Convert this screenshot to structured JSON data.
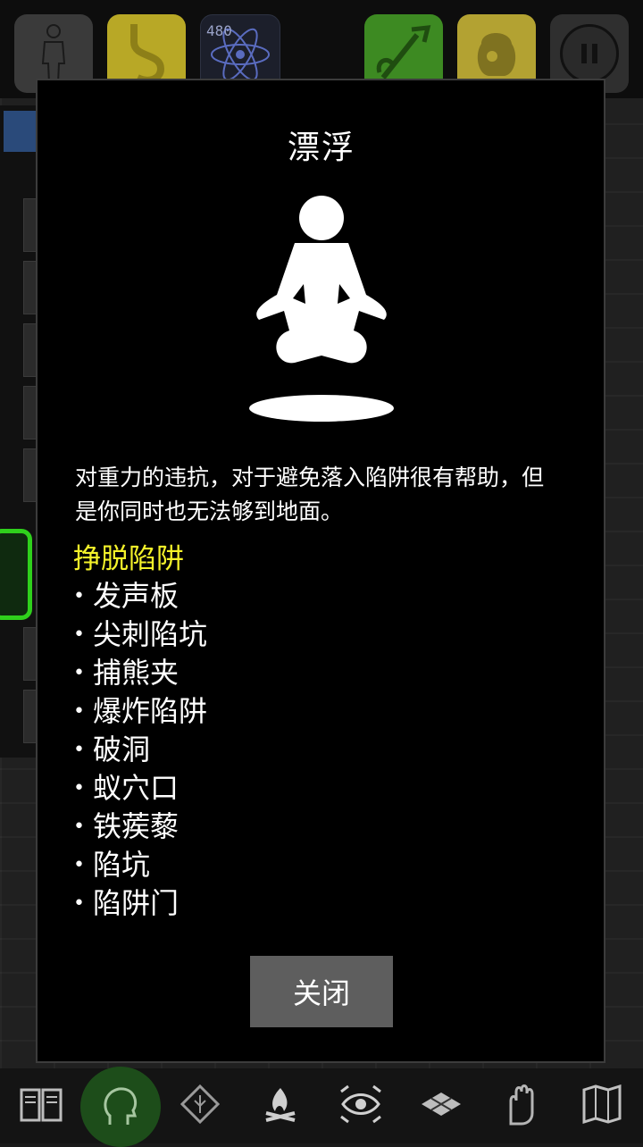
{
  "top_bar": {
    "buttons": [
      {
        "icon": "person-silhouette-icon"
      },
      {
        "icon": "stomach-icon"
      },
      {
        "icon": "atom-icon",
        "counter": "480"
      },
      {
        "icon": "quiver-arrows-icon"
      },
      {
        "icon": "backpack-sack-icon"
      },
      {
        "icon": "pause-icon"
      }
    ]
  },
  "dialog": {
    "title": "漂浮",
    "figure_icon": "levitating-meditation-icon",
    "description": "对重力的违抗，对于避免落入陷阱很有帮助，但是你同时也无法够到地面。",
    "section_heading": "挣脱陷阱",
    "bullet_char": "•",
    "traps": [
      "发声板",
      "尖刺陷坑",
      "捕熊夹",
      "爆炸陷阱",
      "破洞",
      "蚁穴口",
      "铁蒺藜",
      "陷坑",
      "陷阱门"
    ],
    "close_label": "关闭"
  },
  "bottom_bar": {
    "buttons": [
      {
        "icon": "journal-book-icon"
      },
      {
        "icon": "talk-head-icon"
      },
      {
        "icon": "rune-diamond-icon"
      },
      {
        "icon": "campfire-icon"
      },
      {
        "icon": "look-eye-icon"
      },
      {
        "icon": "tiles-grid-icon"
      },
      {
        "icon": "gloved-hand-icon"
      },
      {
        "icon": "map-icon"
      }
    ]
  },
  "colors": {
    "dialog_bg": "#000000",
    "heading_yellow": "#f4f22a",
    "close_button": "#5e5e5e",
    "highlight_green": "#2fd01c"
  }
}
